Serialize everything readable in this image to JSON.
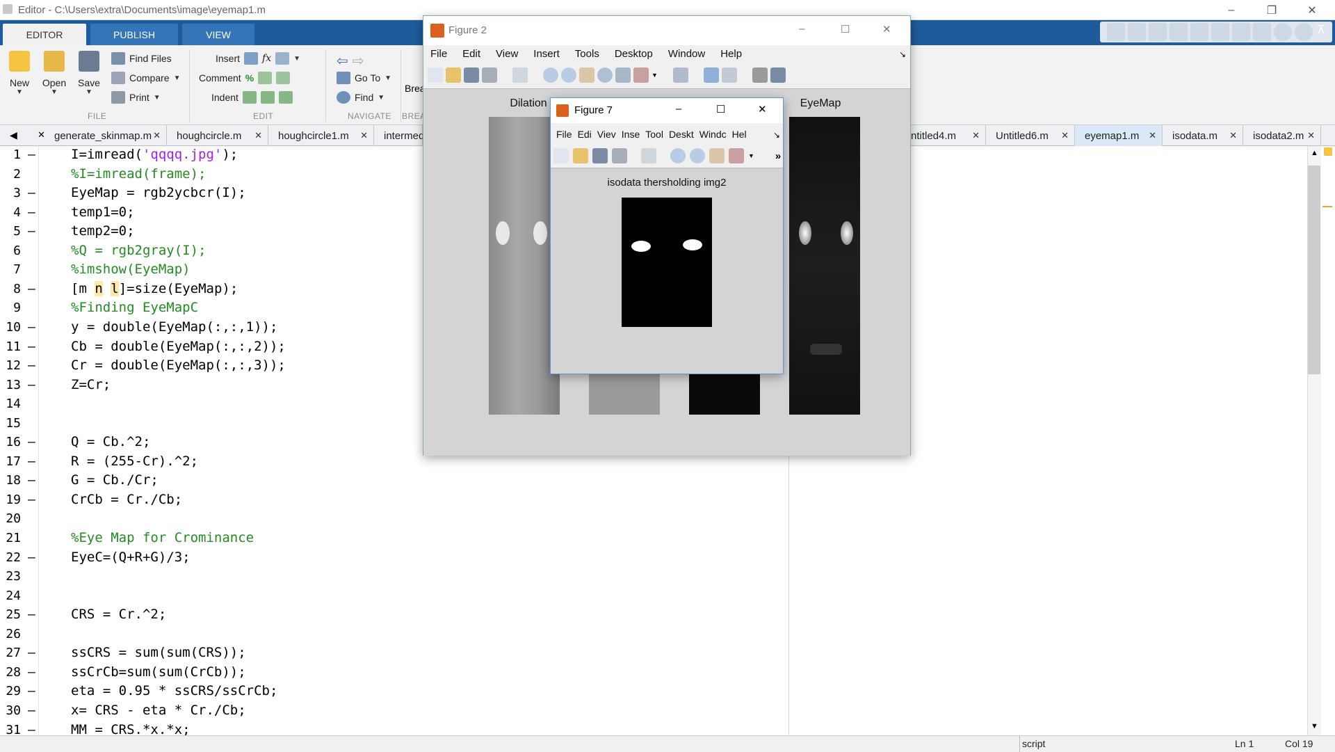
{
  "editor_title": "Editor - C:\\Users\\extra\\Documents\\image\\eyemap1.m",
  "ribbon_tabs": [
    "EDITOR",
    "PUBLISH",
    "VIEW"
  ],
  "file_section": {
    "new": "New",
    "open": "Open",
    "save": "Save",
    "find_files": "Find Files",
    "compare": "Compare",
    "print": "Print",
    "label": "FILE"
  },
  "edit_section": {
    "insert": "Insert",
    "comment": "Comment",
    "indent": "Indent",
    "label": "EDIT"
  },
  "navigate_section": {
    "goto": "Go To",
    "find": "Find",
    "label": "NAVIGATE",
    "bre": "Brea",
    "bre_label": "BREA"
  },
  "file_tabs": [
    "generate_skinmap.m",
    "houghcircle.m",
    "houghcircle1.m",
    "intermed",
    "ntitled4.m",
    "Untitled6.m",
    "eyemap1.m",
    "isodata.m",
    "isodata2.m"
  ],
  "code_lines": [
    {
      "n": "1",
      "d": "–",
      "t": "I=imread(",
      "s": "'qqqq.jpg'",
      "r": ");"
    },
    {
      "n": "2",
      "d": "",
      "c": "%I=imread(frame);"
    },
    {
      "n": "3",
      "d": "–",
      "t": "EyeMap = rgb2ycbcr(I);"
    },
    {
      "n": "4",
      "d": "–",
      "t": "temp1=0;"
    },
    {
      "n": "5",
      "d": "–",
      "t": "temp2=0;"
    },
    {
      "n": "6",
      "d": "",
      "c": "%Q = rgb2gray(I);"
    },
    {
      "n": "7",
      "d": "",
      "c": "%imshow(EyeMap)"
    },
    {
      "n": "8",
      "d": "–",
      "t": "[m n l]=size(EyeMap);"
    },
    {
      "n": "9",
      "d": "",
      "c": "%Finding EyeMapC"
    },
    {
      "n": "10",
      "d": "–",
      "t": "y = double(EyeMap(:,:,1));"
    },
    {
      "n": "11",
      "d": "–",
      "t": "Cb = double(EyeMap(:,:,2));"
    },
    {
      "n": "12",
      "d": "–",
      "t": "Cr = double(EyeMap(:,:,3));"
    },
    {
      "n": "13",
      "d": "–",
      "t": "Z=Cr;"
    },
    {
      "n": "14",
      "d": ""
    },
    {
      "n": "15",
      "d": ""
    },
    {
      "n": "16",
      "d": "–",
      "t": "Q = Cb.^2;"
    },
    {
      "n": "17",
      "d": "–",
      "t": "R = (255-Cr).^2;"
    },
    {
      "n": "18",
      "d": "–",
      "t": "G = Cb./Cr;"
    },
    {
      "n": "19",
      "d": "–",
      "t": "CrCb = Cr./Cb;"
    },
    {
      "n": "20",
      "d": ""
    },
    {
      "n": "21",
      "d": "",
      "c": "%Eye Map for Crominance"
    },
    {
      "n": "22",
      "d": "–",
      "t": "EyeC=(Q+R+G)/3;"
    },
    {
      "n": "23",
      "d": ""
    },
    {
      "n": "24",
      "d": ""
    },
    {
      "n": "25",
      "d": "–",
      "t": "CRS = Cr.^2;"
    },
    {
      "n": "26",
      "d": ""
    },
    {
      "n": "27",
      "d": "–",
      "t": "ssCRS = sum(sum(CRS));"
    },
    {
      "n": "28",
      "d": "–",
      "t": "ssCrCb=sum(sum(CrCb));"
    },
    {
      "n": "29",
      "d": "–",
      "t": "eta = 0.95 * ssCRS/ssCrCb;"
    },
    {
      "n": "30",
      "d": "–",
      "t": "x= CRS - eta * Cr./Cb;"
    },
    {
      "n": "31",
      "d": "–",
      "t": "MM = CRS.*x.*x;"
    }
  ],
  "status": {
    "mode": "script",
    "ln": "Ln  1",
    "col": "Col  19"
  },
  "figure2": {
    "title": "Figure 2",
    "menu": [
      "File",
      "Edit",
      "View",
      "Insert",
      "Tools",
      "Desktop",
      "Window",
      "Help"
    ],
    "axis1": "Dilation",
    "axis4": "EyeMap"
  },
  "figure7": {
    "title": "Figure 7",
    "menu": [
      "File",
      "Edi",
      "Viev",
      "Inse",
      "Tool",
      "Deskt",
      "Windc",
      "Hel"
    ],
    "axis_title": "isodata thersholding img2"
  }
}
